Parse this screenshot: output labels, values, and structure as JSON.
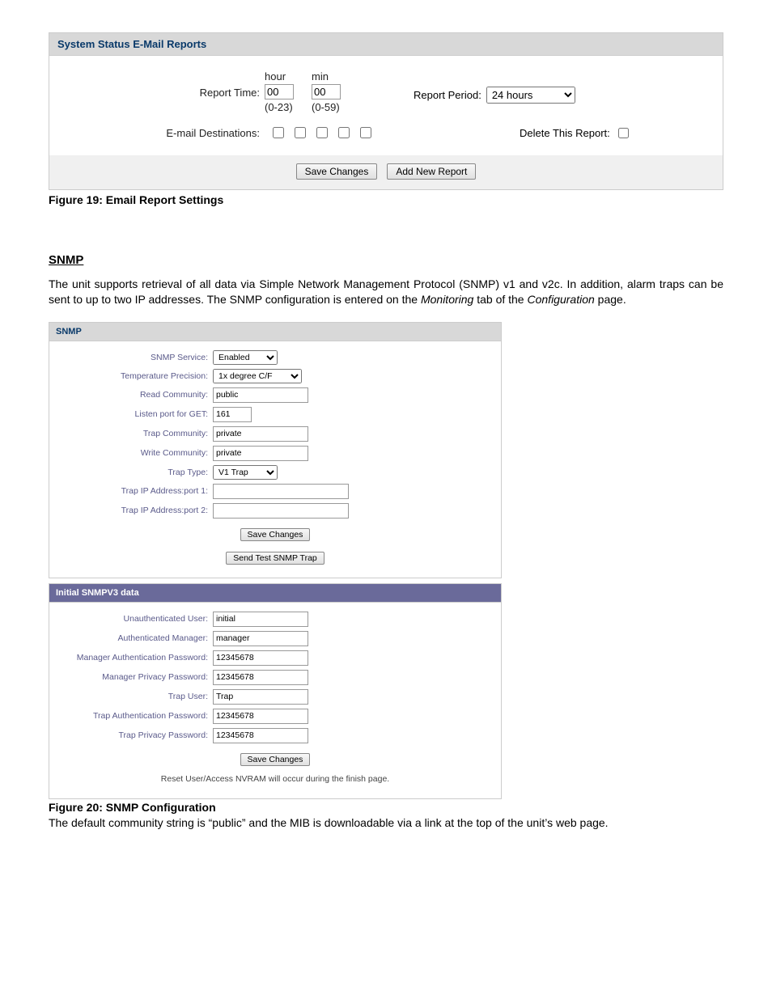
{
  "emailReports": {
    "panelTitle": "System Status E-Mail Reports",
    "reportTimeLabel": "Report Time:",
    "hourHeader": "hour",
    "hourValue": "00",
    "hourFooter": "(0-23)",
    "minHeader": "min",
    "minValue": "00",
    "minFooter": "(0-59)",
    "reportPeriodLabel": "Report Period:",
    "reportPeriodValue": "24 hours",
    "emailDestinationsLabel": "E-mail Destinations:",
    "deleteReportLabel": "Delete This Report:",
    "saveChangesBtn": "Save Changes",
    "addNewReportBtn": "Add New Report"
  },
  "figure19": "Figure 19: Email Report Settings",
  "snmpHeading": "SNMP",
  "snmpIntroPart1": "The unit supports retrieval of all data via Simple Network Management Protocol (SNMP) v1 and v2c.  In addition, alarm traps can be sent to up to two IP addresses.  The SNMP configuration is entered on the ",
  "snmpIntroItalic1": "Monitoring",
  "snmpIntroPart2": " tab of the ",
  "snmpIntroItalic2": "Configuration",
  "snmpIntroPart3": " page.",
  "snmpPanel": {
    "title": "SNMP",
    "rows": {
      "service": {
        "label": "SNMP Service:",
        "value": "Enabled"
      },
      "precision": {
        "label": "Temperature Precision:",
        "value": "1x degree C/F"
      },
      "readCommunity": {
        "label": "Read Community:",
        "value": "public"
      },
      "listenPort": {
        "label": "Listen port for GET:",
        "value": "161"
      },
      "trapCommunity": {
        "label": "Trap Community:",
        "value": "private"
      },
      "writeCommunity": {
        "label": "Write Community:",
        "value": "private"
      },
      "trapType": {
        "label": "Trap Type:",
        "value": "V1 Trap"
      },
      "trapIp1": {
        "label": "Trap IP Address:port 1:",
        "value": ""
      },
      "trapIp2": {
        "label": "Trap IP Address:port 2:",
        "value": ""
      }
    },
    "saveChangesBtn": "Save Changes",
    "sendTestBtn": "Send Test SNMP Trap"
  },
  "snmpv3Panel": {
    "title": "Initial SNMPV3 data",
    "rows": {
      "unauthUser": {
        "label": "Unauthenticated User:",
        "value": "initial"
      },
      "authManager": {
        "label": "Authenticated Manager:",
        "value": "manager"
      },
      "managerAuthPwd": {
        "label": "Manager Authentication Password:",
        "value": "12345678"
      },
      "managerPrivPwd": {
        "label": "Manager Privacy Password:",
        "value": "12345678"
      },
      "trapUser": {
        "label": "Trap User:",
        "value": "Trap"
      },
      "trapAuthPwd": {
        "label": "Trap Authentication Password:",
        "value": "12345678"
      },
      "trapPrivPwd": {
        "label": "Trap Privacy Password:",
        "value": "12345678"
      }
    },
    "saveChangesBtn": "Save Changes",
    "note": "Reset User/Access NVRAM will occur during the finish page."
  },
  "figure20": "Figure 20: SNMP Configuration",
  "closingText": "The default community string is “public” and the MIB is downloadable via a link at the top of the unit’s web page."
}
